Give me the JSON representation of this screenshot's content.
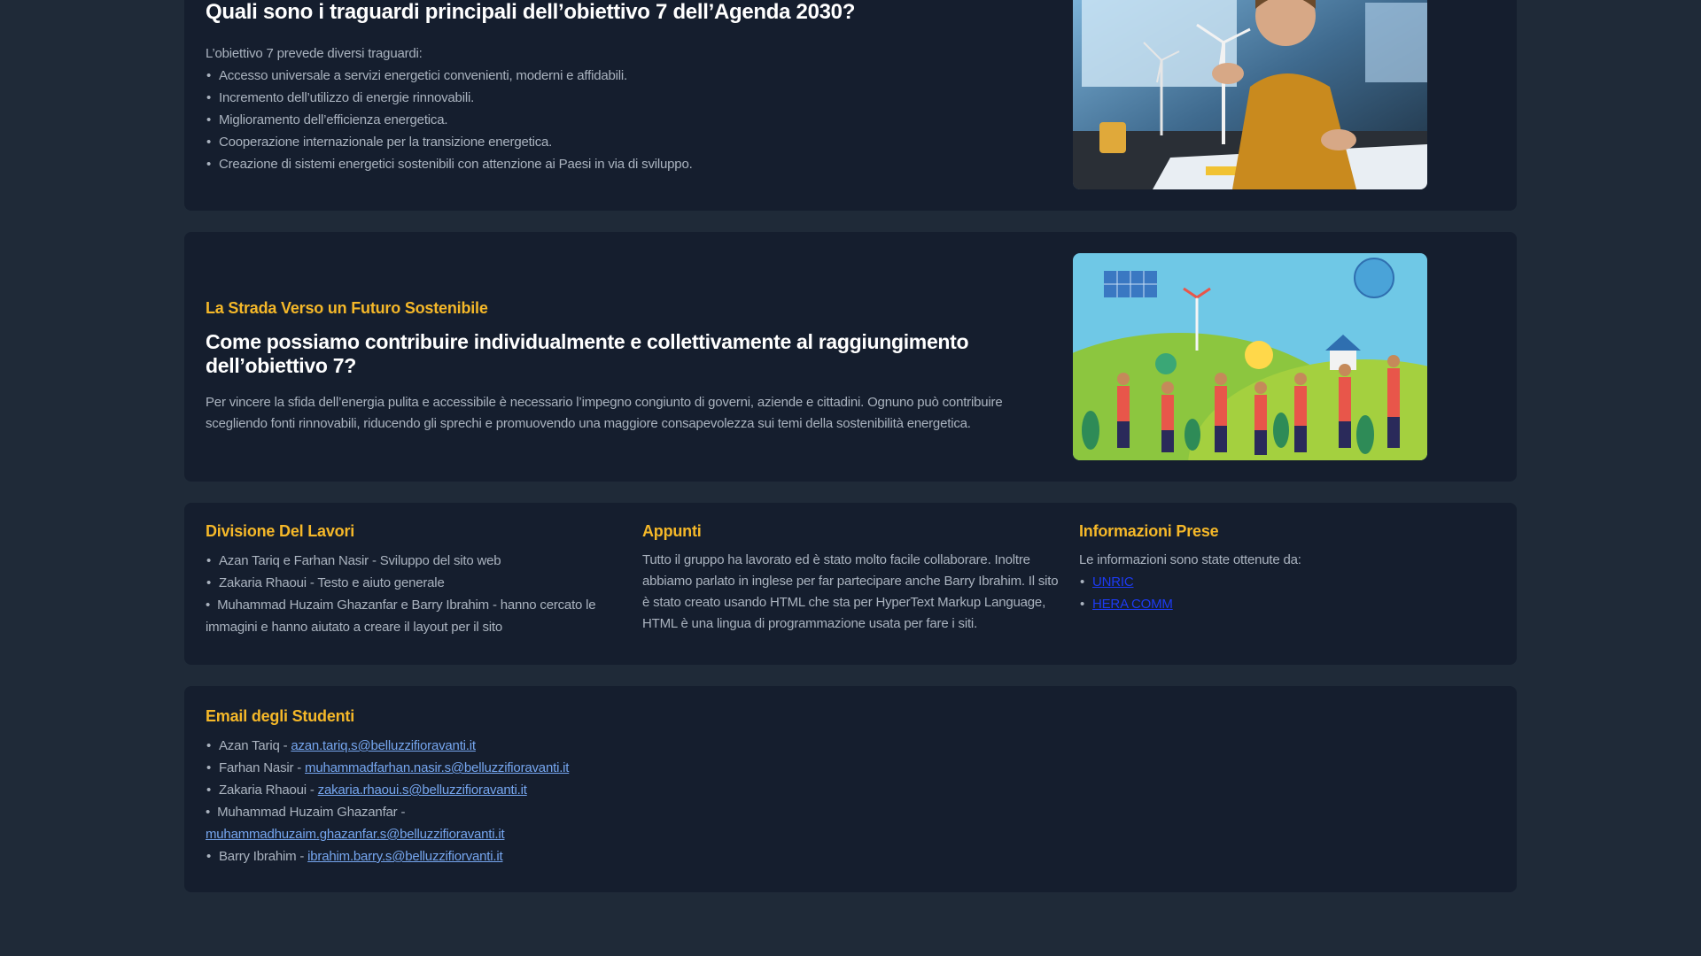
{
  "goals": {
    "title": "Quali sono i traguardi principali dell’obiettivo 7 dell’Agenda 2030?",
    "intro": "L’obiettivo 7 prevede diversi traguardi:",
    "items": [
      "Accesso universale a servizi energetici convenienti, moderni e affidabili.",
      "Incremento dell’utilizzo di energie rinnovabili.",
      "Miglioramento dell’efficienza energetica.",
      "Cooperazione internazionale per la transizione energetica.",
      "Creazione di sistemi energetici sostenibili con attenzione ai Paesi in via di sviluppo."
    ]
  },
  "road": {
    "kicker": "La Strada Verso un Futuro Sostenibile",
    "title": "Come possiamo contribuire individualmente e collettivamente al raggiungimento dell’obiettivo 7?",
    "body": "Per vincere la sfida dell’energia pulita e accessibile è necessario l’impegno congiunto di governi, aziende e cittadini. Ognuno può contribuire scegliendo fonti rinnovabili, riducendo gli sprechi e promuovendo una maggiore consapevolezza sui temi della sostenibilità energetica."
  },
  "division": {
    "title": "Divisione Del Lavori",
    "items": [
      "Azan Tariq e Farhan Nasir - Sviluppo del sito web",
      "Zakaria Rhaoui - Testo e aiuto generale",
      "Muhammad Huzaim Ghazanfar e Barry Ibrahim - hanno cercato le immagini e hanno aiutato a creare il layout per il sito"
    ]
  },
  "notes": {
    "title": "Appunti",
    "body": "Tutto il gruppo ha lavorato ed è stato molto facile collaborare. Inoltre abbiamo parlato in inglese per far partecipare anche Barry Ibrahim. Il sito è stato creato usando HTML che sta per HyperText Markup Language, HTML è una lingua di programmazione usata per fare i siti."
  },
  "sources": {
    "title": "Informazioni Prese",
    "intro": "Le informazioni sono state ottenute da:",
    "links": [
      "UNRIC",
      "HERA COMM"
    ]
  },
  "emails": {
    "title": "Email degli Studenti",
    "items": [
      {
        "name": "Azan Tariq - ",
        "email": "azan.tariq.s@belluzzifioravanti.it"
      },
      {
        "name": "Farhan Nasir - ",
        "email": "muhammadfarhan.nasir.s@belluzzifioravanti.it"
      },
      {
        "name": "Zakaria Rhaoui - ",
        "email": "zakaria.rhaoui.s@belluzzifioravanti.it"
      },
      {
        "name": "Muhammad Huzaim Ghazanfar - ",
        "email": "muhammadhuzaim.ghazanfar.s@belluzzifioravanti.it"
      },
      {
        "name": "Barry Ibrahim - ",
        "email": "ibrahim.barry.s@belluzzifiorvanti.it"
      }
    ]
  },
  "colors": {
    "page_bg": "#1f2a38",
    "card_bg": "#151e2e",
    "accent": "#f5b829",
    "link": "#76a6ef"
  }
}
